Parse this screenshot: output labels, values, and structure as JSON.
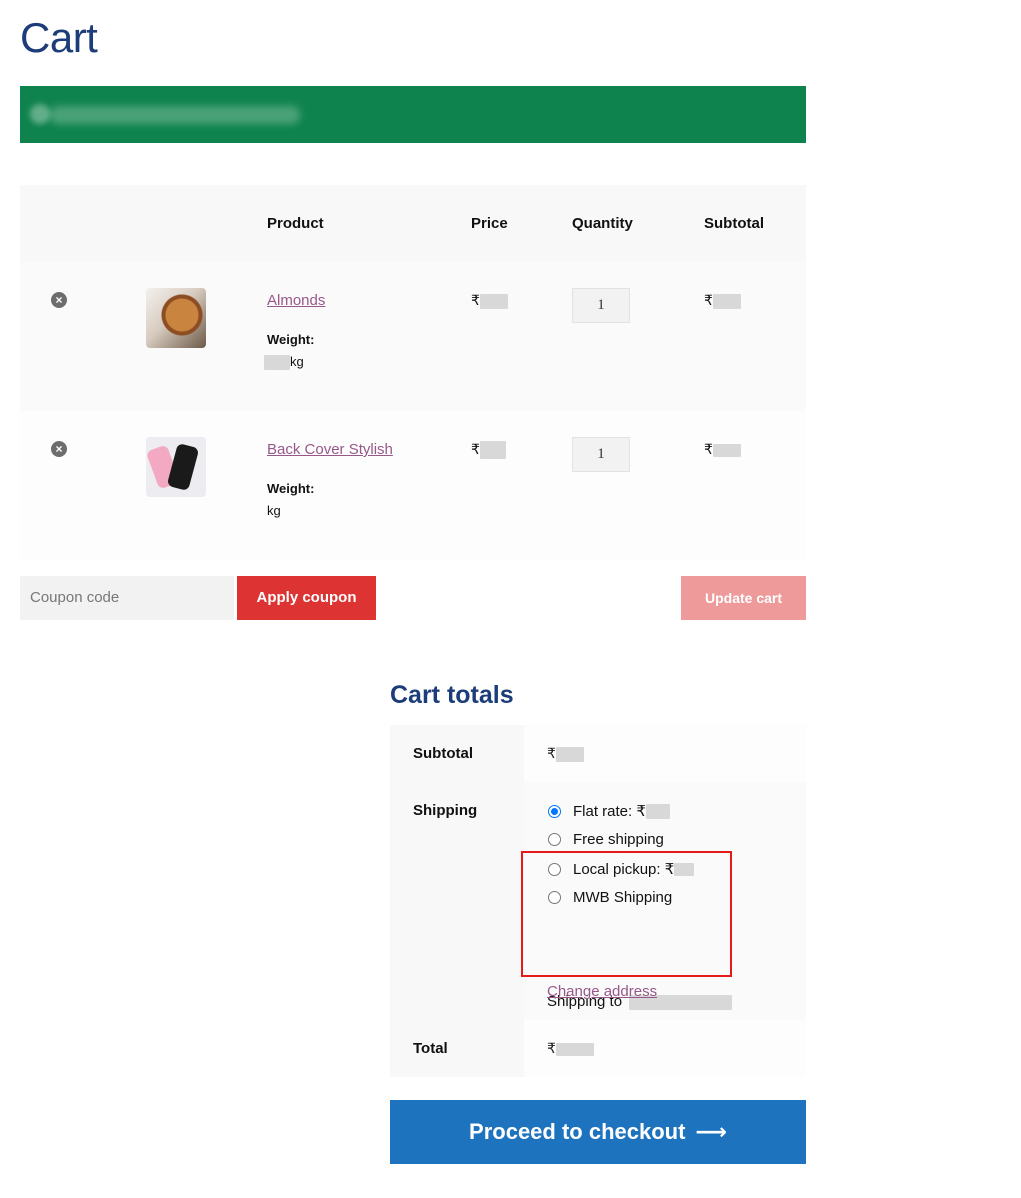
{
  "page": {
    "title": "Cart"
  },
  "table": {
    "headers": {
      "product": "Product",
      "price": "Price",
      "quantity": "Quantity",
      "subtotal": "Subtotal"
    },
    "items": [
      {
        "name": "Almonds",
        "weight_label": "Weight:",
        "weight_unit": "kg",
        "quantity": "1",
        "currency": "₹",
        "remove_icon": "close-circle-icon",
        "image": "almonds-thumbnail"
      },
      {
        "name": "Back Cover Stylish",
        "weight_label": "Weight:",
        "weight_unit": "kg",
        "quantity": "1",
        "currency": "₹",
        "remove_icon": "close-circle-icon",
        "image": "phone-cover-thumbnail"
      }
    ]
  },
  "actions": {
    "coupon_placeholder": "Coupon code",
    "apply_coupon": "Apply coupon",
    "update_cart": "Update cart"
  },
  "totals": {
    "title": "Cart totals",
    "subtotal_label": "Subtotal",
    "shipping_label": "Shipping",
    "total_label": "Total",
    "currency": "₹",
    "shipping_options": [
      {
        "label": "Flat rate: ₹",
        "selected": true
      },
      {
        "label": "Free shipping",
        "selected": false
      },
      {
        "label": "Local pickup: ₹",
        "selected": false
      },
      {
        "label": "MWB Shipping",
        "selected": false
      }
    ],
    "shipping_to": "Shipping to",
    "change_address": "Change address"
  },
  "checkout": {
    "label": "Proceed to checkout",
    "arrow": "⟶"
  },
  "colors": {
    "notice_bg": "#0f834d",
    "apply_btn": "#dd3333",
    "update_btn": "#ee9a9a",
    "checkout_btn": "#1e73be",
    "link": "#96588a",
    "title": "#1c3d7a",
    "highlight_border": "#e41b1b"
  }
}
